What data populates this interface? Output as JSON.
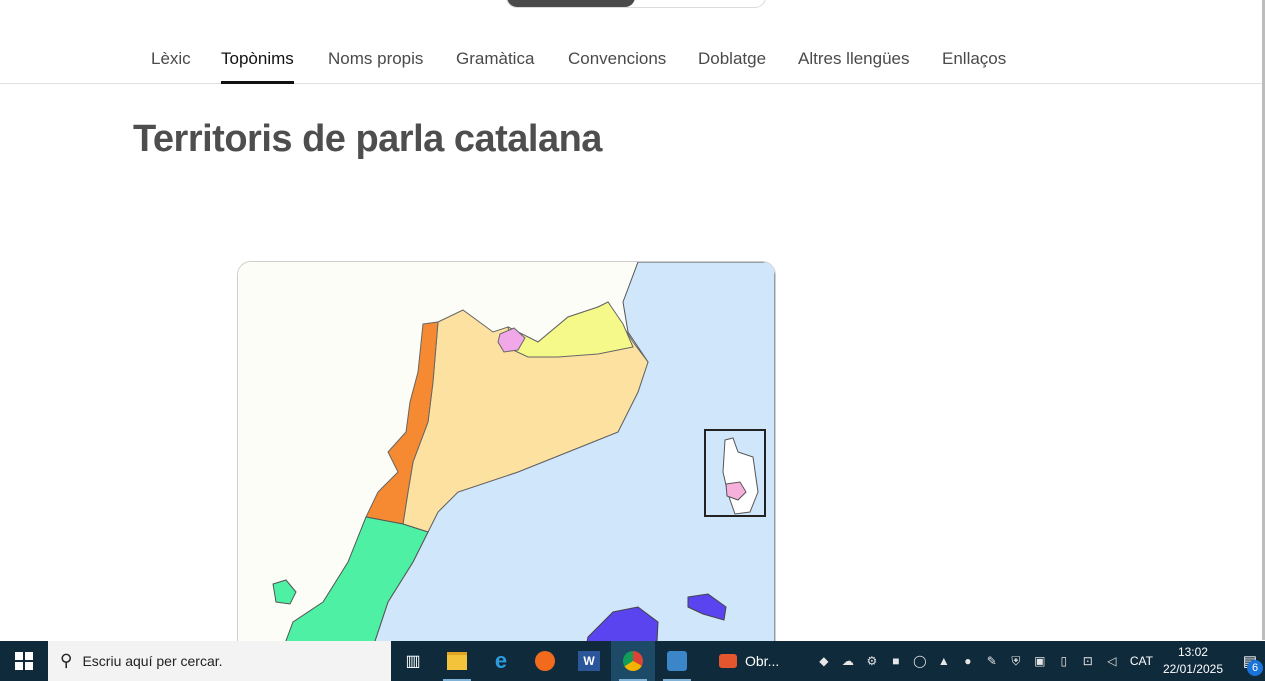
{
  "nav": {
    "tabs": [
      {
        "label": "Lèxic",
        "active": false
      },
      {
        "label": "Topònims",
        "active": true
      },
      {
        "label": "Noms propis",
        "active": false
      },
      {
        "label": "Gramàtica",
        "active": false
      },
      {
        "label": "Convencions",
        "active": false
      },
      {
        "label": "Doblatge",
        "active": false
      },
      {
        "label": "Altres llengües",
        "active": false
      },
      {
        "label": "Enllaços",
        "active": false
      }
    ]
  },
  "page": {
    "title": "Territoris de parla catalana"
  },
  "map": {
    "colors": {
      "sea": "#cfe6fb",
      "catalonia": "#fde1a0",
      "franja": "#f58a32",
      "valencia": "#4ef0a4",
      "north_catalonia": "#f5f98a",
      "andorra": "#f0a8e8",
      "balears": "#5a44f0",
      "alguer": "#f5b0dc"
    }
  },
  "taskbar": {
    "search_placeholder": "Escriu aquí per cercar.",
    "running_app_label": "Obr...",
    "language": "CAT",
    "time": "13:02",
    "date": "22/01/2025",
    "notification_count": "6",
    "icons": [
      "windows-start-icon",
      "task-view-icon",
      "file-explorer-icon",
      "edge-icon",
      "firefox-icon",
      "word-icon",
      "chrome-icon",
      "photos-icon",
      "app-icon"
    ]
  }
}
